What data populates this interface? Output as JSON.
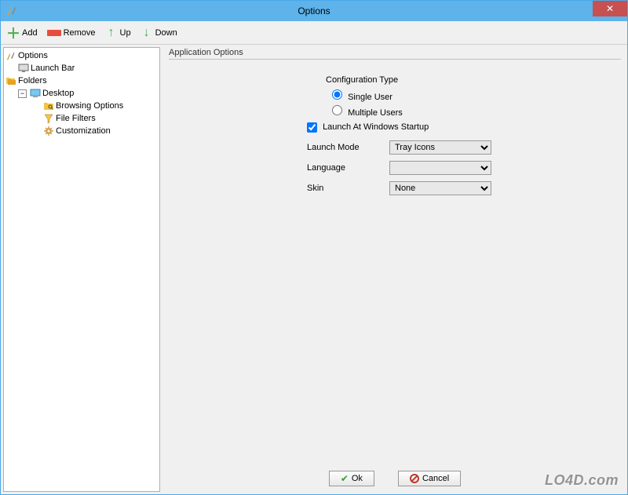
{
  "window": {
    "title": "Options"
  },
  "toolbar": {
    "add": "Add",
    "remove": "Remove",
    "up": "Up",
    "down": "Down"
  },
  "tree": {
    "options": "Options",
    "launch_bar": "Launch Bar",
    "folders": "Folders",
    "desktop": "Desktop",
    "browsing_options": "Browsing Options",
    "file_filters": "File Filters",
    "customization": "Customization"
  },
  "panel": {
    "title": "Application Options",
    "config_type_label": "Configuration Type",
    "single_user": "Single User",
    "multiple_users": "Multiple Users",
    "launch_startup": "Launch At Windows Startup",
    "launch_mode_label": "Launch Mode",
    "launch_mode_value": "Tray Icons",
    "language_label": "Language",
    "language_value": "",
    "skin_label": "Skin",
    "skin_value": "None"
  },
  "buttons": {
    "ok": "Ok",
    "cancel": "Cancel"
  },
  "watermark": "LO4D.com"
}
